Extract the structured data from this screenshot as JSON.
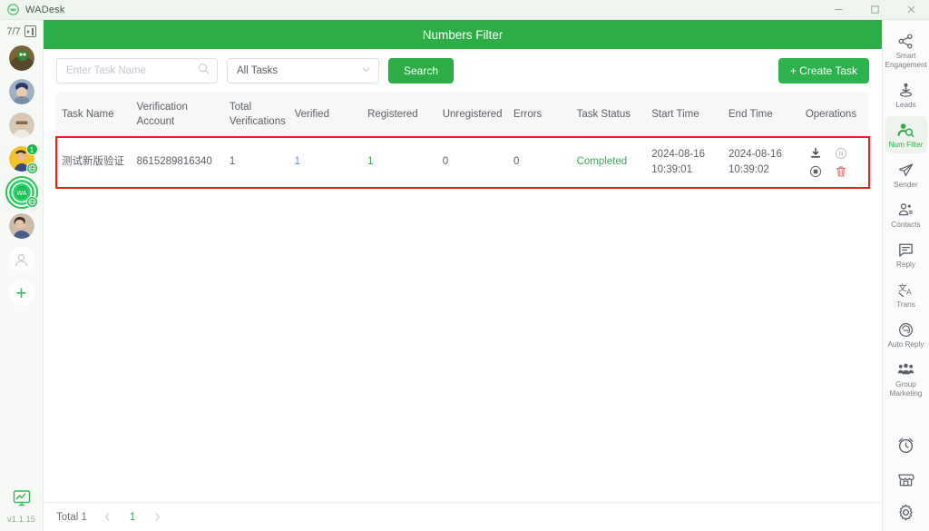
{
  "window": {
    "app_title": "WADesk",
    "logo_icon": "wa-logo-icon",
    "minimize_icon": "minimize-icon",
    "maximize_icon": "maximize-icon",
    "close_icon": "close-icon"
  },
  "left_rail": {
    "account_counter": "7/7",
    "counter_icon": "panel-toggle-icon",
    "accounts": [
      {
        "name": "account-avatar-1",
        "badge": null,
        "globe": false,
        "selected": false,
        "colors": [
          "#6d5a33",
          "#2f8a3c"
        ]
      },
      {
        "name": "account-avatar-2",
        "badge": null,
        "globe": false,
        "selected": false,
        "colors": [
          "#8e9fb5",
          "#2b3a66"
        ]
      },
      {
        "name": "account-avatar-3",
        "badge": null,
        "globe": false,
        "selected": false,
        "colors": [
          "#cdbfae",
          "#8a7a68"
        ]
      },
      {
        "name": "account-avatar-4",
        "badge": "1",
        "globe": true,
        "selected": false,
        "colors": [
          "#f3c32b",
          "#3a4a7a"
        ]
      },
      {
        "name": "account-avatar-wa",
        "badge": null,
        "globe": true,
        "selected": true,
        "colors": [
          "#25d366",
          "#12a34a"
        ],
        "label": "WA"
      },
      {
        "name": "account-avatar-6",
        "badge": null,
        "globe": false,
        "selected": false,
        "colors": [
          "#c9b7a6",
          "#4a5d8a"
        ]
      }
    ],
    "add_contact_icon": "person-icon",
    "add_account_icon": "plus-icon",
    "status_icon": "monitor-chart-icon",
    "version": "v1.1.15"
  },
  "page": {
    "title": "Numbers Filter"
  },
  "toolbar": {
    "search_placeholder": "Enter Task Name",
    "search_value": "",
    "search_icon": "search-icon",
    "filter_selected": "All Tasks",
    "filter_chevron_icon": "chevron-down-icon",
    "search_button": "Search",
    "create_button": "+ Create Task"
  },
  "table": {
    "columns": [
      "Task Name",
      "Verification Account",
      "Total Verifications",
      "Verified",
      "Registered",
      "Unregistered",
      "Errors",
      "Task Status",
      "Start Time",
      "End Time",
      "Operations"
    ],
    "rows": [
      {
        "task_name": "测试新版验证",
        "verification_account": "8615289816340",
        "total_verifications": "1",
        "verified": "1",
        "registered": "1",
        "unregistered": "0",
        "errors": "0",
        "task_status": "Completed",
        "start_date": "2024-08-16",
        "start_time": "10:39:01",
        "end_date": "2024-08-16",
        "end_time": "10:39:02",
        "operations": [
          {
            "name": "download-icon"
          },
          {
            "name": "pause-icon"
          },
          {
            "name": "stop-icon"
          },
          {
            "name": "delete-icon"
          }
        ],
        "highlighted": true
      }
    ]
  },
  "footer": {
    "total_label": "Total 1",
    "prev_icon": "chevron-left-icon",
    "current_page": "1",
    "next_icon": "chevron-right-icon"
  },
  "right_rail": {
    "items": [
      {
        "label": "Smart Engagement",
        "icon": "share-nodes-icon",
        "active": false
      },
      {
        "label": "Leads",
        "icon": "leads-target-icon",
        "active": false
      },
      {
        "label": "Num Filter",
        "icon": "user-search-icon",
        "active": true
      },
      {
        "label": "Sender",
        "icon": "paper-plane-icon",
        "active": false
      },
      {
        "label": "Contacts",
        "icon": "contacts-icon",
        "active": false
      },
      {
        "label": "Reply",
        "icon": "reply-message-icon",
        "active": false
      },
      {
        "label": "Trans",
        "icon": "translate-icon",
        "active": false
      },
      {
        "label": "Auto Reply",
        "icon": "auto-reply-headset-icon",
        "active": false
      },
      {
        "label": "Group Marketing",
        "icon": "group-people-icon",
        "active": false
      }
    ],
    "bottom_icons": [
      {
        "name": "alarm-clock-icon"
      },
      {
        "name": "store-icon"
      },
      {
        "name": "gear-icon"
      }
    ]
  },
  "colors": {
    "brand_green": "#2cad48",
    "header_green": "#2cad48",
    "highlight_red": "#f01b1b",
    "status_green": "#3aab58",
    "verified_blue": "#6f8dbf"
  }
}
